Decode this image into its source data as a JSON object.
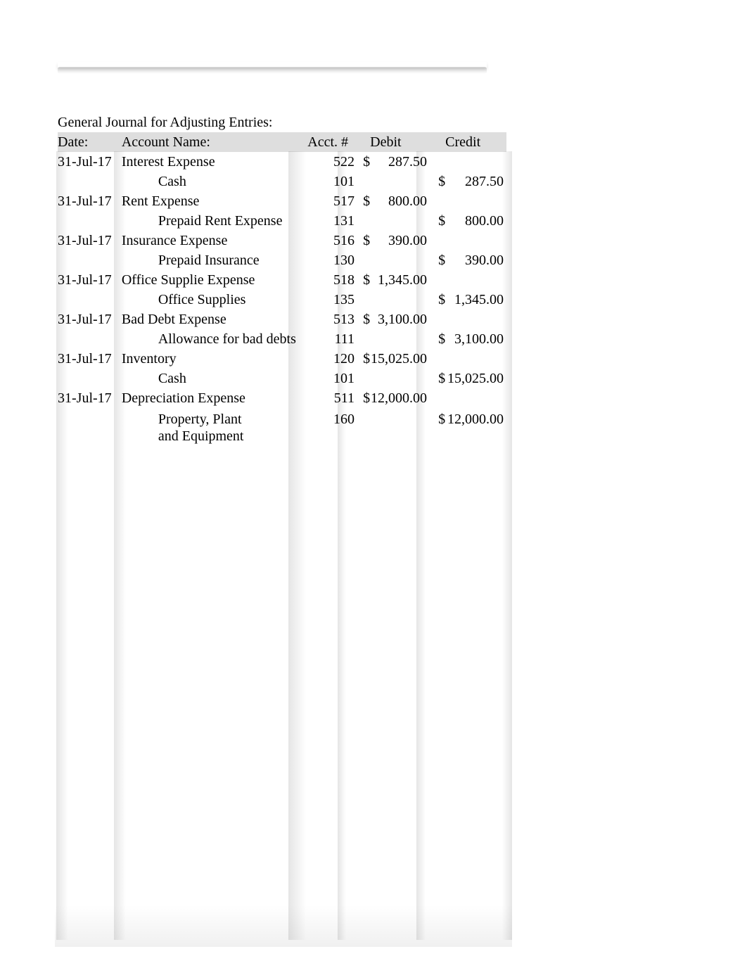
{
  "title": "General Journal for Adjusting Entries:",
  "headers": {
    "date": "Date:",
    "name": "Account Name:",
    "acct": "Acct. #",
    "debit": "Debit",
    "credit": "Credit"
  },
  "rows": [
    {
      "date": "31-Jul-17",
      "name": "Interest Expense",
      "indent": false,
      "acct": "522",
      "dsym": "$",
      "debit": "287.50",
      "csym": "",
      "credit": ""
    },
    {
      "date": "",
      "name": "Cash",
      "indent": true,
      "acct": "101",
      "dsym": "",
      "debit": "",
      "csym": "$",
      "credit": "287.50"
    },
    {
      "date": "31-Jul-17",
      "name": "Rent Expense",
      "indent": false,
      "acct": "517",
      "dsym": "$",
      "debit": "800.00",
      "csym": "",
      "credit": ""
    },
    {
      "date": "",
      "name": "Prepaid Rent Expense",
      "indent": true,
      "acct": "131",
      "dsym": "",
      "debit": "",
      "csym": "$",
      "credit": "800.00"
    },
    {
      "date": "31-Jul-17",
      "name": "Insurance Expense",
      "indent": false,
      "acct": "516",
      "dsym": "$",
      "debit": "390.00",
      "csym": "",
      "credit": ""
    },
    {
      "date": "",
      "name": "Prepaid Insurance",
      "indent": true,
      "acct": "130",
      "dsym": "",
      "debit": "",
      "csym": "$",
      "credit": "390.00"
    },
    {
      "date": "31-Jul-17",
      "name": "Office Supplie Expense",
      "indent": false,
      "acct": "518",
      "dsym": "$",
      "debit": "1,345.00",
      "csym": "",
      "credit": ""
    },
    {
      "date": "",
      "name": "Office Supplies",
      "indent": true,
      "acct": "135",
      "dsym": "",
      "debit": "",
      "csym": "$",
      "credit": "1,345.00"
    },
    {
      "date": "31-Jul-17",
      "name": "Bad Debt Expense",
      "indent": false,
      "acct": "513",
      "dsym": "$",
      "debit": "3,100.00",
      "csym": "",
      "credit": ""
    },
    {
      "date": "",
      "name": "Allowance for bad debts",
      "indent": true,
      "acct": "111",
      "dsym": "",
      "debit": "",
      "csym": "$",
      "credit": "3,100.00"
    },
    {
      "date": "31-Jul-17",
      "name": "Inventory",
      "indent": false,
      "acct": "120",
      "dsym": "$",
      "debit": "15,025.00",
      "csym": "",
      "credit": ""
    },
    {
      "date": "",
      "name": "Cash",
      "indent": true,
      "acct": "101",
      "dsym": "",
      "debit": "",
      "csym": "$",
      "credit": "15,025.00"
    },
    {
      "date": "31-Jul-17",
      "name": "Depreciation Expense",
      "indent": false,
      "acct": "511",
      "dsym": "$",
      "debit": "12,000.00",
      "csym": "",
      "credit": ""
    },
    {
      "date": "",
      "name": "Property, Plant and Equipment",
      "indent": true,
      "multiline": true,
      "acct": "160",
      "dsym": "",
      "debit": "",
      "csym": "$",
      "credit": "12,000.00"
    }
  ]
}
